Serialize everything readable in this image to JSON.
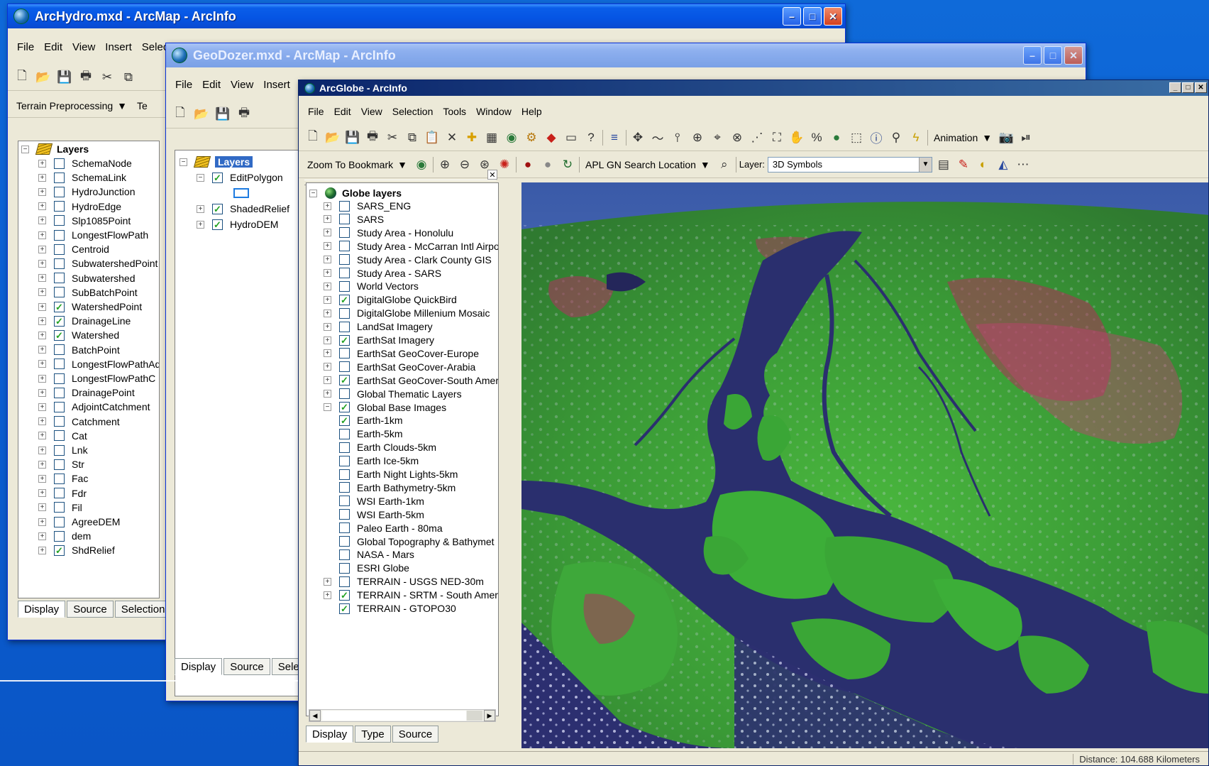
{
  "win1": {
    "title": "ArcHydro.mxd - ArcMap - ArcInfo",
    "menu": [
      "File",
      "Edit",
      "View",
      "Insert",
      "Selec"
    ],
    "toolbar2": [
      "Terrain Preprocessing",
      "Te"
    ],
    "root": "Layers",
    "layers": [
      {
        "name": "SchemaNode",
        "checked": false
      },
      {
        "name": "SchemaLink",
        "checked": false
      },
      {
        "name": "HydroJunction",
        "checked": false
      },
      {
        "name": "HydroEdge",
        "checked": false
      },
      {
        "name": "Slp1085Point",
        "checked": false
      },
      {
        "name": "LongestFlowPath",
        "checked": false
      },
      {
        "name": "Centroid",
        "checked": false
      },
      {
        "name": "SubwatershedPoint",
        "checked": false
      },
      {
        "name": "Subwatershed",
        "checked": false
      },
      {
        "name": "SubBatchPoint",
        "checked": false
      },
      {
        "name": "WatershedPoint",
        "checked": true
      },
      {
        "name": "DrainageLine",
        "checked": true
      },
      {
        "name": "Watershed",
        "checked": true
      },
      {
        "name": "BatchPoint",
        "checked": false
      },
      {
        "name": "LongestFlowPathAd",
        "checked": false
      },
      {
        "name": "LongestFlowPathC",
        "checked": false
      },
      {
        "name": "DrainagePoint",
        "checked": false
      },
      {
        "name": "AdjointCatchment",
        "checked": false
      },
      {
        "name": "Catchment",
        "checked": false
      },
      {
        "name": "Cat",
        "checked": false
      },
      {
        "name": "Lnk",
        "checked": false
      },
      {
        "name": "Str",
        "checked": false
      },
      {
        "name": "Fac",
        "checked": false
      },
      {
        "name": "Fdr",
        "checked": false
      },
      {
        "name": "Fil",
        "checked": false
      },
      {
        "name": "AgreeDEM",
        "checked": false
      },
      {
        "name": "dem",
        "checked": false
      },
      {
        "name": "ShdRelief",
        "checked": true
      }
    ],
    "tabs": [
      "Display",
      "Source",
      "Selection"
    ]
  },
  "win2": {
    "title": "GeoDozer.mxd - ArcMap - ArcInfo",
    "menu": [
      "File",
      "Edit",
      "View",
      "Insert"
    ],
    "root": "Layers",
    "layers": [
      {
        "name": "EditPolygon",
        "checked": true,
        "expanded": true
      },
      {
        "name": "ShadedRelief",
        "checked": true,
        "expanded": false
      },
      {
        "name": "HydroDEM",
        "checked": true,
        "expanded": false
      }
    ],
    "tabs": [
      "Display",
      "Source",
      "Selec"
    ]
  },
  "win3": {
    "title": "ArcGlobe - ArcInfo",
    "menu": [
      "File",
      "Edit",
      "View",
      "Selection",
      "Tools",
      "Window",
      "Help"
    ],
    "animation_label": "Animation",
    "zoom_bookmark_label": "Zoom To Bookmark",
    "search_location_label": "APL GN Search Location",
    "layer_label": "Layer:",
    "layer_value": "3D Symbols",
    "root": "Globe layers",
    "layers": [
      {
        "name": "SARS_ENG",
        "checked": false
      },
      {
        "name": "SARS",
        "checked": false
      },
      {
        "name": "Study Area - Honolulu",
        "checked": false
      },
      {
        "name": "Study Area - McCarran Intl Airport",
        "checked": false
      },
      {
        "name": "Study Area - Clark County GIS",
        "checked": false
      },
      {
        "name": "Study Area - SARS",
        "checked": false
      },
      {
        "name": "World Vectors",
        "checked": false
      },
      {
        "name": "DigitalGlobe QuickBird",
        "checked": true
      },
      {
        "name": "DigitalGlobe Millenium Mosaic",
        "checked": false
      },
      {
        "name": "LandSat Imagery",
        "checked": false
      },
      {
        "name": "EarthSat Imagery",
        "checked": true
      },
      {
        "name": "EarthSat GeoCover-Europe",
        "checked": false
      },
      {
        "name": "EarthSat GeoCover-Arabia",
        "checked": false
      },
      {
        "name": "EarthSat GeoCover-South America",
        "checked": true
      },
      {
        "name": "Global Thematic Layers",
        "checked": false
      },
      {
        "name": "Global Base Images",
        "checked": true,
        "expanded": true
      },
      {
        "name": "Earth-1km",
        "checked": true,
        "child": true
      },
      {
        "name": "Earth-5km",
        "checked": false,
        "child": true
      },
      {
        "name": "Earth Clouds-5km",
        "checked": false,
        "child": true
      },
      {
        "name": "Earth Ice-5km",
        "checked": false,
        "child": true
      },
      {
        "name": "Earth Night Lights-5km",
        "checked": false,
        "child": true
      },
      {
        "name": "Earth Bathymetry-5km",
        "checked": false,
        "child": true
      },
      {
        "name": "WSI Earth-1km",
        "checked": false,
        "child": true
      },
      {
        "name": "WSI Earth-5km",
        "checked": false,
        "child": true
      },
      {
        "name": "Paleo Earth - 80ma",
        "checked": false,
        "child": true
      },
      {
        "name": "Global Topography & Bathymet",
        "checked": false,
        "child": true
      },
      {
        "name": "NASA - Mars",
        "checked": false,
        "child": true
      },
      {
        "name": "ESRI Globe",
        "checked": false,
        "child": true
      },
      {
        "name": "TERRAIN - USGS NED-30m",
        "checked": false
      },
      {
        "name": "TERRAIN - SRTM - South America -",
        "checked": true
      },
      {
        "name": "TERRAIN - GTOPO30",
        "checked": true,
        "noexp": true
      }
    ],
    "tabs": [
      "Display",
      "Type",
      "Source"
    ],
    "status": "Distance: 104.688 Kilometers"
  },
  "colors": {
    "accent": "#0a5ee9",
    "water": "#2a2f6e",
    "land": "#3fa83a"
  }
}
